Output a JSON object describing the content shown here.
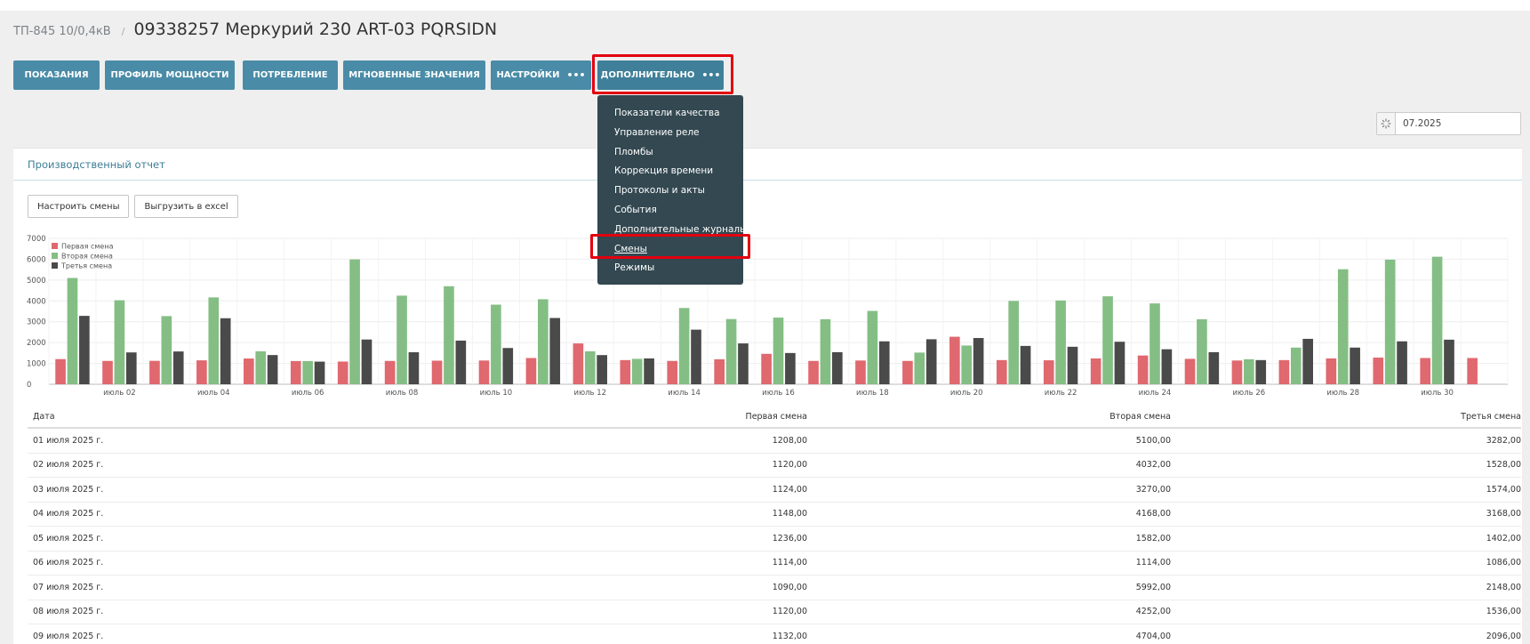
{
  "header": {
    "breadcrumb": "ТП-845 10/0,4кВ",
    "separator": "/",
    "title": "09338257 Меркурий 230 ART-03 PQRSIDN"
  },
  "nav": {
    "buttons": [
      {
        "label": "ПОКАЗАНИЯ"
      },
      {
        "label": "ПРОФИЛЬ МОЩНОСТИ"
      },
      {
        "label": "ПОТРЕБЛЕНИЕ"
      },
      {
        "label": "МГНОВЕННЫЕ ЗНАЧЕНИЯ"
      },
      {
        "label": "НАСТРОЙКИ",
        "dots": "•••"
      },
      {
        "label": "ДОПОЛНИТЕЛЬНО",
        "dots": "•••"
      }
    ]
  },
  "dropdown": {
    "items": [
      "Показатели качества",
      "Управление реле",
      "Пломбы",
      "Коррекция времени",
      "Протоколы и акты",
      "События",
      "Дополнительные журналы",
      "Смены",
      "Режимы"
    ],
    "selected": "Смены"
  },
  "date_picker": {
    "value": "07.2025",
    "icon": "spinner-icon"
  },
  "panel": {
    "title": "Производственный отчет",
    "configure_label": "Настроить смены",
    "export_label": "Выгрузить в excel"
  },
  "colors": {
    "first": "#e0686f",
    "second": "#84be84",
    "third": "#4a4a4a",
    "nav": "#4a8ca7",
    "dropdown": "#334851",
    "highlight": "#e3000f"
  },
  "chart_data": {
    "type": "bar",
    "ylim": [
      0,
      7000
    ],
    "yticks": [
      0,
      1000,
      2000,
      3000,
      4000,
      5000,
      6000,
      7000
    ],
    "xtick_labels": [
      "июль 02",
      "июль 04",
      "июль 06",
      "июль 08",
      "июль 10",
      "июль 12",
      "июль 14",
      "июль 16",
      "июль 18",
      "июль 20",
      "июль 22",
      "июль 24",
      "июль 26",
      "июль 28",
      "июль 30"
    ],
    "xtick_days": [
      2,
      4,
      6,
      8,
      10,
      12,
      14,
      16,
      18,
      20,
      22,
      24,
      26,
      28,
      30
    ],
    "grid": true,
    "legend": "top-left",
    "series": [
      {
        "name": "Первая смена",
        "color": "#e0686f",
        "values": [
          1208,
          1120,
          1124,
          1148,
          1236,
          1114,
          1090,
          1120,
          1132,
          1140,
          1260,
          1960,
          1160,
          1120,
          1200,
          1460,
          1120,
          1140,
          1120,
          2280,
          1160,
          1150,
          1240,
          1380,
          1220,
          1140,
          1160,
          1240,
          1280,
          1260,
          1260
        ]
      },
      {
        "name": "Вторая смена",
        "color": "#84be84",
        "values": [
          5100,
          4032,
          3270,
          4168,
          1582,
          1114,
          5992,
          4252,
          4704,
          3820,
          4080,
          1580,
          1220,
          3660,
          3130,
          3200,
          3120,
          3520,
          1520,
          1860,
          4000,
          4020,
          4220,
          3880,
          3120,
          1200,
          1760,
          5520,
          5980,
          6120,
          null
        ]
      },
      {
        "name": "Третья смена",
        "color": "#4a4a4a",
        "values": [
          3282,
          1528,
          1574,
          3168,
          1402,
          1086,
          2148,
          1536,
          2096,
          1740,
          3180,
          1400,
          1240,
          2620,
          1960,
          1500,
          1540,
          2060,
          2160,
          2220,
          1840,
          1800,
          2040,
          1680,
          1540,
          1160,
          2180,
          1760,
          2060,
          2140,
          null
        ]
      }
    ]
  },
  "table": {
    "headers": [
      "Дата",
      "Первая смена",
      "Вторая смена",
      "Третья смена"
    ],
    "rows": [
      [
        "01 июля 2025 г.",
        "1208,00",
        "5100,00",
        "3282,00"
      ],
      [
        "02 июля 2025 г.",
        "1120,00",
        "4032,00",
        "1528,00"
      ],
      [
        "03 июля 2025 г.",
        "1124,00",
        "3270,00",
        "1574,00"
      ],
      [
        "04 июля 2025 г.",
        "1148,00",
        "4168,00",
        "3168,00"
      ],
      [
        "05 июля 2025 г.",
        "1236,00",
        "1582,00",
        "1402,00"
      ],
      [
        "06 июля 2025 г.",
        "1114,00",
        "1114,00",
        "1086,00"
      ],
      [
        "07 июля 2025 г.",
        "1090,00",
        "5992,00",
        "2148,00"
      ],
      [
        "08 июля 2025 г.",
        "1120,00",
        "4252,00",
        "1536,00"
      ],
      [
        "09 июля 2025 г.",
        "1132,00",
        "4704,00",
        "2096,00"
      ]
    ]
  }
}
